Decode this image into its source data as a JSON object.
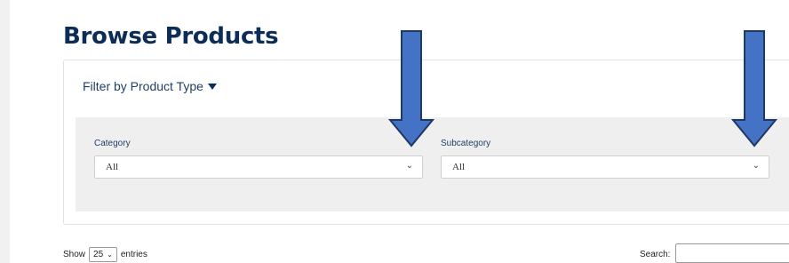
{
  "page": {
    "title": "Browse Products"
  },
  "filter": {
    "toggle_label": "Filter by Product Type",
    "category": {
      "label": "Category",
      "value": "All"
    },
    "subcategory": {
      "label": "Subcategory",
      "value": "All"
    }
  },
  "table_controls": {
    "show_label": "Show",
    "entries_value": "25",
    "entries_label": "entries",
    "search_label": "Search:",
    "search_value": ""
  },
  "icons": {
    "caret": "caret-down-icon",
    "chevron": "chevron-down-icon",
    "annotation_arrow": "arrow-down-icon"
  },
  "colors": {
    "title": "#0c2d57",
    "annotation_arrow_fill": "#4472c4",
    "annotation_arrow_stroke": "#1f3864",
    "filter_body": "#efefef"
  }
}
